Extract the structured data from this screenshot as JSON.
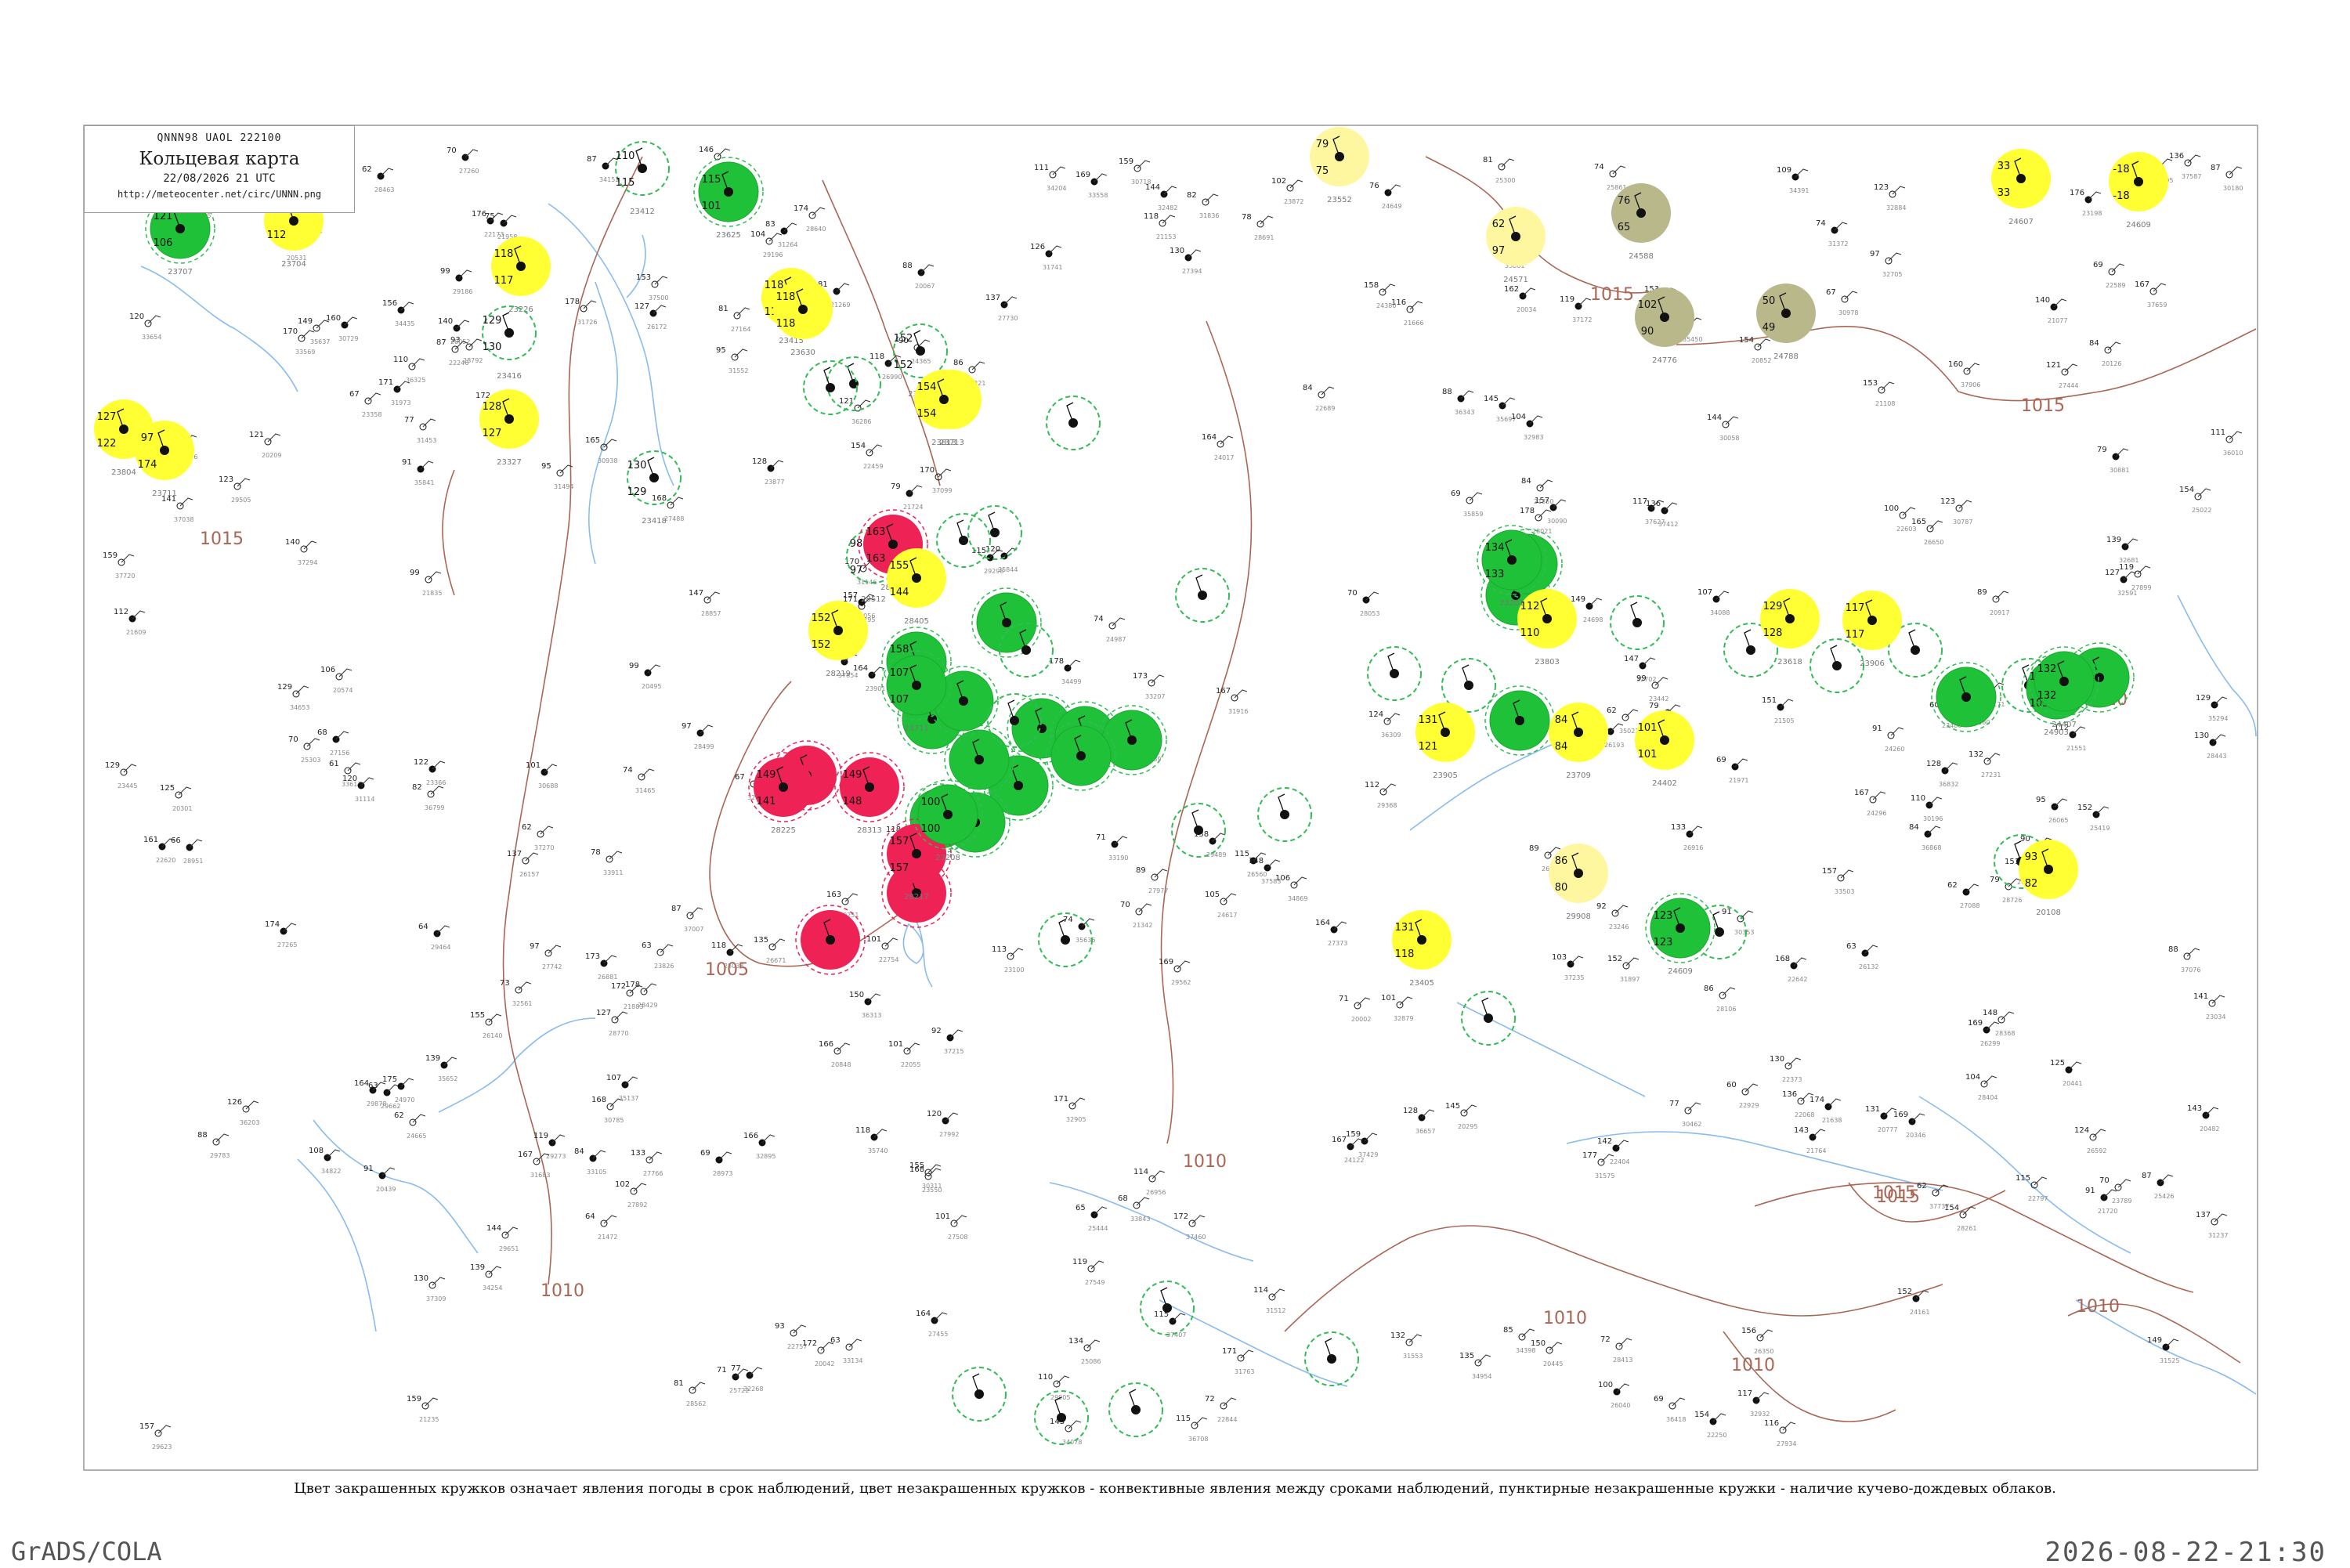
{
  "header": {
    "code": "QNNN98  UAOL  222100",
    "title": "Кольцевая карта",
    "date": "22/08/2026 21 UTC",
    "url": "http://meteocenter.net/circ/UNNN.png"
  },
  "caption": "Цвет закрашенных кружков означает явления погоды в срок наблюдений, цвет незакрашенных кружков - конвективные явления между сроками наблюдений, пунктирные незакрашенные кружки - наличие кучево-дождевых облаков.",
  "footer": {
    "left": "GrADS/COLA",
    "right": "2026-08-22-21:30"
  },
  "isobars": [
    {
      "label": "1015"
    },
    {
      "label": "1005"
    },
    {
      "label": "1010"
    },
    {
      "label": "1010"
    },
    {
      "label": "1015"
    },
    {
      "label": "1015"
    },
    {
      "label": "1010"
    },
    {
      "label": "1010"
    },
    {
      "label": "1015"
    },
    {
      "label": "1010"
    },
    {
      "label": "1010"
    },
    {
      "label": "1015"
    }
  ],
  "colors": {
    "green": "#1fc138",
    "yellow": "#ffff33",
    "red": "#ee2255",
    "olive": "#b8b88a",
    "pale": "#fff7a0",
    "river": "#88bbee",
    "isobar": "#aa6655"
  },
  "stations": [
    {
      "t": "121",
      "p": "106",
      "n": "23707",
      "k": "green"
    },
    {
      "t": "153",
      "p": "112",
      "n": "23704",
      "k": "yellow"
    },
    {
      "t": "110",
      "p": "115",
      "n": "23412",
      "k": "dgreen"
    },
    {
      "t": "115",
      "p": "101",
      "n": "23625",
      "k": "green"
    },
    {
      "t": "118",
      "p": "117",
      "n": "23226",
      "k": "yellow"
    },
    {
      "t": "118",
      "p": "118",
      "n": "23415",
      "k": "yellow"
    },
    {
      "t": "154",
      "p": "117",
      "n": "23713",
      "k": "yellow"
    },
    {
      "t": "129",
      "p": "130",
      "n": "23416",
      "k": "dgreen"
    },
    {
      "t": "127",
      "p": "122",
      "n": "23804",
      "k": "yellow"
    },
    {
      "t": "97",
      "p": "174",
      "n": "23711",
      "k": "yellow"
    },
    {
      "t": "128",
      "p": "127",
      "n": "23327",
      "k": "yellow"
    },
    {
      "t": "130",
      "p": "129",
      "n": "23418",
      "k": "dgreen"
    },
    {
      "t": "79",
      "p": "75",
      "n": "23552",
      "k": "pale"
    },
    {
      "t": "33",
      "p": "33",
      "n": "24607",
      "k": "yellow"
    },
    {
      "t": "-18",
      "p": "-18",
      "n": "24609",
      "k": "yellow"
    },
    {
      "t": "76",
      "p": "65",
      "n": "24588",
      "k": "olive"
    },
    {
      "t": "62",
      "p": "97",
      "n": "24571",
      "k": "pale"
    },
    {
      "t": "102",
      "p": "90",
      "n": "24776",
      "k": "olive"
    },
    {
      "t": "50",
      "p": "49",
      "n": "24788",
      "k": "olive"
    },
    {
      "t": "118",
      "p": "118",
      "n": "23630",
      "k": "yellow"
    },
    {
      "t": "152",
      "p": "152",
      "n": "23632",
      "k": "dgreen"
    },
    {
      "t": "154",
      "p": "154",
      "n": "23813",
      "k": "yellow"
    },
    {
      "t": "98",
      "p": "97",
      "n": "28512",
      "k": "dgreen"
    },
    {
      "t": "163",
      "p": "163",
      "n": "28102",
      "k": "red"
    },
    {
      "t": "155",
      "p": "144",
      "n": "28405",
      "k": "yellow"
    },
    {
      "t": "152",
      "p": "152",
      "n": "28219",
      "k": "yellow"
    },
    {
      "t": "158",
      "p": "150",
      "n": "28411",
      "k": "green"
    },
    {
      "t": "149",
      "p": "141",
      "n": "28225",
      "k": "red"
    },
    {
      "t": "149",
      "p": "148",
      "n": "28313",
      "k": "red"
    },
    {
      "t": "157",
      "p": "157",
      "n": "28217",
      "k": "red"
    },
    {
      "t": "112",
      "p": "110",
      "n": "23803",
      "k": "yellow"
    },
    {
      "t": "134",
      "p": "133",
      "n": "23201",
      "k": "green"
    },
    {
      "t": "129",
      "p": "128",
      "n": "23618",
      "k": "yellow"
    },
    {
      "t": "117",
      "p": "117",
      "n": "23906",
      "k": "yellow"
    },
    {
      "t": "131",
      "p": "121",
      "n": "23905",
      "k": "yellow"
    },
    {
      "t": "84",
      "p": "84",
      "n": "23709",
      "k": "yellow"
    },
    {
      "t": "101",
      "p": "101",
      "n": "24402",
      "k": "yellow"
    },
    {
      "t": "131",
      "p": "118",
      "n": "23405",
      "k": "yellow"
    },
    {
      "t": "86",
      "p": "80",
      "n": "29908",
      "k": "pale"
    },
    {
      "t": "93",
      "p": "82",
      "n": "20108",
      "k": "yellow"
    },
    {
      "t": "107",
      "p": "107",
      "n": "23711",
      "k": "green"
    },
    {
      "t": "100",
      "p": "100",
      "n": "23208",
      "k": "green"
    },
    {
      "t": "123",
      "p": "123",
      "n": "24609",
      "k": "green"
    },
    {
      "t": "103",
      "p": "103",
      "n": "24903",
      "k": "green"
    },
    {
      "t": "132",
      "p": "132",
      "n": "24407",
      "k": "green"
    }
  ]
}
